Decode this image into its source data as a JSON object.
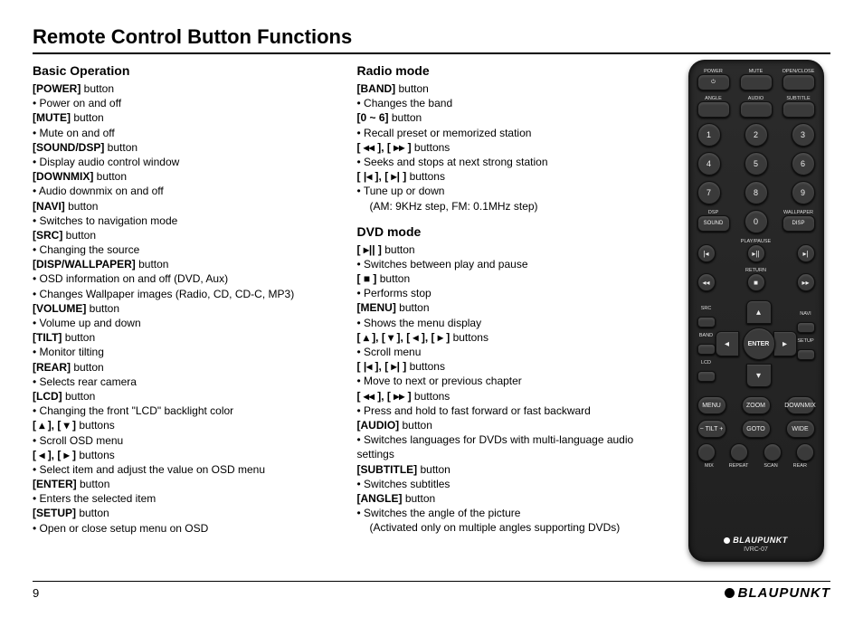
{
  "title": "Remote Control Button Functions",
  "page_number": "9",
  "brand": "BLAUPUNKT",
  "remote": {
    "brand": "BLAUPUNKT",
    "model": "IVRC-07",
    "top_labels": [
      "POWER",
      "MUTE",
      "OPEN/CLOSE",
      "ANGLE",
      "AUDIO",
      "SUBTITLE"
    ],
    "numpad": [
      "1",
      "2",
      "3",
      "4",
      "5",
      "6",
      "7",
      "8",
      "9",
      "0"
    ],
    "mid_labels": [
      "DSP",
      "WALLPAPER",
      "SOUND",
      "DISP"
    ],
    "playpause": "PLAY/PAUSE",
    "return": "RETURN",
    "side_labels": [
      "SRC",
      "NAVI",
      "BAND",
      "SETUP",
      "LCD"
    ],
    "enter": "ENTER",
    "bottom_rows": [
      [
        "MENU",
        "ZOOM",
        "DOWNMIX"
      ],
      [
        "− TILT +",
        "GOTO",
        "WIDE"
      ],
      [
        "MIX",
        "REPEAT",
        "SCAN",
        "REAR"
      ]
    ]
  },
  "sections": {
    "basic": {
      "title": "Basic Operation",
      "items": [
        {
          "label": "[POWER]",
          "suffix": " button",
          "desc": "• Power on and off"
        },
        {
          "label": "[MUTE]",
          "suffix": " button",
          "desc": "• Mute on and off"
        },
        {
          "label": "[SOUND/DSP]",
          "suffix": " button",
          "desc": "• Display audio control window"
        },
        {
          "label": "[DOWNMIX]",
          "suffix": " button",
          "desc": "• Audio downmix on and off"
        },
        {
          "label": "[NAVI]",
          "suffix": " button",
          "desc": "• Switches to navigation mode"
        },
        {
          "label": "[SRC]",
          "suffix": " button",
          "desc": "• Changing the source"
        },
        {
          "label": "[DISP/WALLPAPER]",
          "suffix": " button",
          "desc": "• OSD information on and off (DVD, Aux)",
          "desc2": "• Changes Wallpaper images (Radio, CD, CD-C, MP3)"
        },
        {
          "label": "[VOLUME]",
          "suffix": " button",
          "desc": "• Volume up and down"
        },
        {
          "label": "[TILT]",
          "suffix": " button",
          "desc": "• Monitor tilting"
        },
        {
          "label": "[REAR]",
          "suffix": " button",
          "desc": "• Selects rear camera"
        },
        {
          "label": "[LCD]",
          "suffix": " button",
          "desc": "• Changing the front \"LCD\" backlight color"
        },
        {
          "label": "[ ▴ ], [ ▾ ]",
          "suffix": " buttons",
          "desc": "• Scroll OSD menu"
        },
        {
          "label": "[ ◂ ], [ ▸ ]",
          "suffix": " buttons",
          "desc": "• Select item and adjust the value on OSD menu"
        },
        {
          "label": "[ENTER]",
          "suffix": " button",
          "desc": "• Enters the selected item"
        },
        {
          "label": "[SETUP]",
          "suffix": " button",
          "desc": "• Open or close setup menu on OSD"
        }
      ]
    },
    "radio": {
      "title": "Radio mode",
      "items": [
        {
          "label": "[BAND]",
          "suffix": " button",
          "desc": "• Changes the band"
        },
        {
          "label": "[0 ~ 6]",
          "suffix": " button",
          "desc": "• Recall preset or memorized station"
        },
        {
          "label": "[ ◂◂ ], [ ▸▸ ]",
          "suffix": " buttons",
          "desc": "• Seeks and stops at next strong station"
        },
        {
          "label": "[ |◂ ], [ ▸| ]",
          "suffix": " buttons",
          "desc": "• Tune up or down",
          "sub": "(AM: 9KHz step, FM: 0.1MHz step)"
        }
      ]
    },
    "dvd": {
      "title": "DVD mode",
      "items": [
        {
          "label": "[ ▸|| ]",
          "suffix": " button",
          "desc": "• Switches between play and pause"
        },
        {
          "label": "[ ■ ]",
          "suffix": " button",
          "desc": "• Performs stop"
        },
        {
          "label": "[MENU]",
          "suffix": " button",
          "desc": "• Shows the menu display"
        },
        {
          "label": "[ ▴ ], [ ▾ ], [ ◂ ], [ ▸ ]",
          "suffix": " buttons",
          "desc": "• Scroll menu"
        },
        {
          "label": "[ |◂ ], [ ▸| ]",
          "suffix": " buttons",
          "desc": "• Move to next or previous chapter"
        },
        {
          "label": "[ ◂◂ ], [ ▸▸ ]",
          "suffix": " buttons",
          "desc": "• Press and hold to fast forward or fast backward"
        },
        {
          "label": "[AUDIO]",
          "suffix": " button",
          "desc": "• Switches languages for DVDs with multi-language audio settings"
        },
        {
          "label": "[SUBTITLE]",
          "suffix": " button",
          "desc": "• Switches subtitles"
        },
        {
          "label": "[ANGLE]",
          "suffix": " button",
          "desc": "• Switches the angle of the picture",
          "sub": "(Activated only on multiple angles supporting DVDs)"
        }
      ]
    }
  }
}
